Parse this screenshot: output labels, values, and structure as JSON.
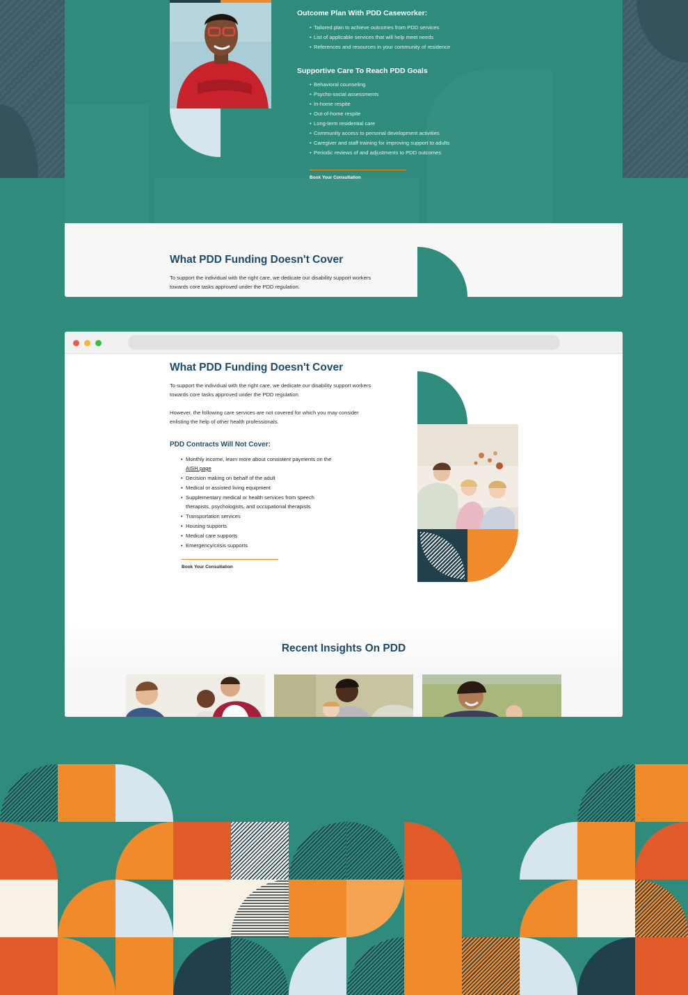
{
  "outcome_plan": {
    "heading": "Outcome Plan With PDD Caseworker:",
    "items": [
      "Tailored plan to achieve outcomes from PDD services",
      "List of applicable services that will help meet needs",
      "References and resources in your community of residence"
    ]
  },
  "supportive_care": {
    "heading": "Supportive Care To Reach PDD Goals",
    "items": [
      "Behavioral counseling",
      "Psycho-social assessments",
      "In-home respite",
      "Out-of-home respite",
      "Long-term residential care",
      "Community access to personal development activities",
      "Caregiver and staff training for improving support to adults",
      "Periodic reviews of and adjustments to PDD outcomes"
    ],
    "cta": "Book Your Consultation"
  },
  "card_preview": {
    "title": "What PDD Funding Doesn't Cover",
    "text_line1": "To support the individual with the right care, we dedicate our disability support workers",
    "text_line2": "towards core tasks approved under the PDD regulation."
  },
  "browser": {
    "title": "What PDD Funding Doesn't Cover",
    "intro_line1": "To support the individual with the right care, we dedicate our disability support workers",
    "intro_line2": "towards core tasks approved under the PDD regulation.",
    "para2_line1": "However, the following care services are not covered for which you may consider",
    "para2_line2": "enlisting the help of other health professionals.",
    "contracts_heading": "PDD Contracts Will Not Cover:",
    "item1_text": "Monthly income, learn more about consistent payments on the",
    "item1_link": "AISH page",
    "items": [
      "Decision making on behalf of the adult",
      "Medical or assisted living equipment",
      "Supplementary medical or health services from speech therapists, psychologists, and occupational therapists",
      "Transportation services",
      "Housing supports",
      "Medical care supports",
      "Emergency/crisis supports"
    ],
    "cta": "Book Your Consultation",
    "insights_heading": "Recent Insights On PDD"
  },
  "colors": {
    "teal": "#2f8c7d",
    "navy": "#1d4a6b",
    "orange": "#f08a2a",
    "dark": "#22404c",
    "light_blue": "#d6e6ec",
    "cream": "#f8f1e6"
  },
  "icons": [
    "window-close-dot",
    "window-minimize-dot",
    "window-maximize-dot"
  ]
}
